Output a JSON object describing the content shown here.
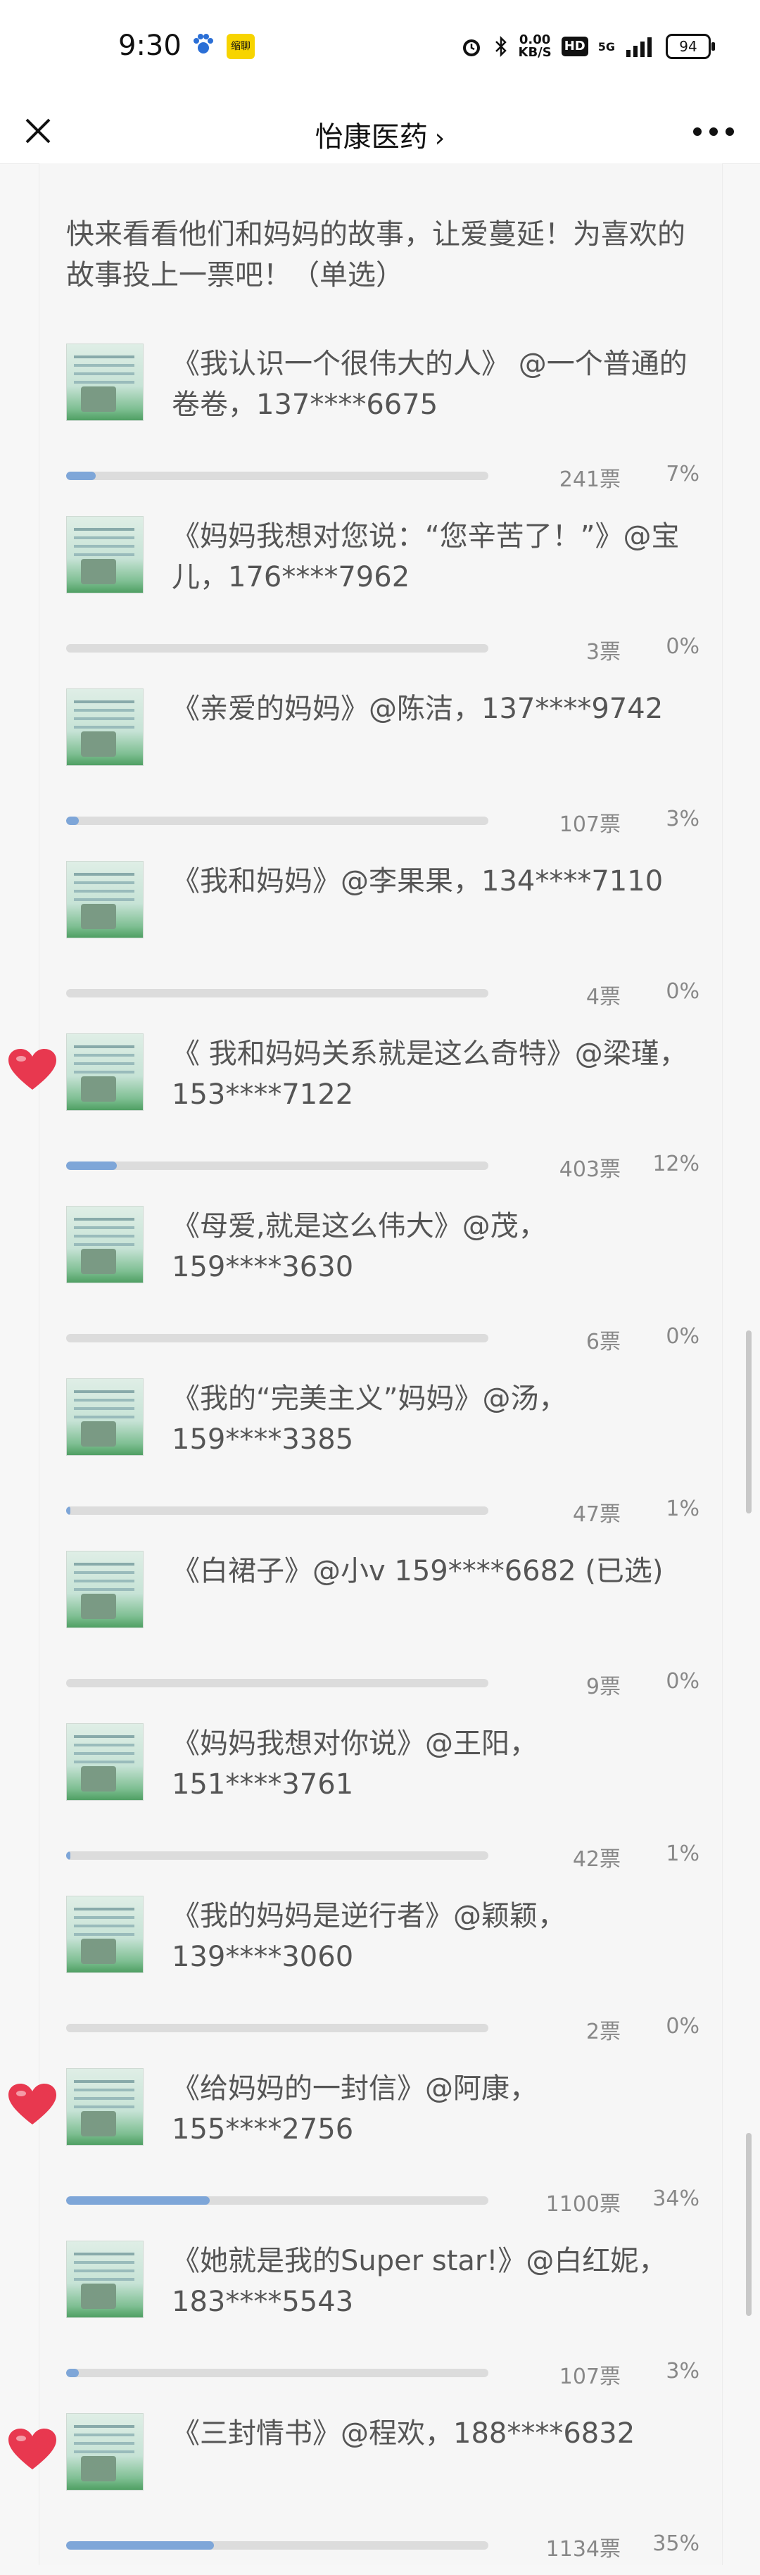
{
  "status_bar": {
    "time": "9:30",
    "app_badge": "缩聊",
    "network_speed": "0.00\nKB/S",
    "hd": "HD",
    "signal": "5G",
    "battery": "94"
  },
  "nav": {
    "title": "怡康医药",
    "chevron": "›"
  },
  "intro": "快来看看他们和妈妈的故事，让爱蔓延！为喜欢的故事投上一票吧！（单选）",
  "options": [
    {
      "text": "《我认识一个很伟大的人》 @一个普通的卷卷，137****6675",
      "votes_label": "241票",
      "pct_label": "7%",
      "pct": 7,
      "hearted": false
    },
    {
      "text": "《妈妈我想对您说：“您辛苦了！”》@宝儿，176****7962",
      "votes_label": "3票",
      "pct_label": "0%",
      "pct": 0,
      "hearted": false
    },
    {
      "text": "《亲爱的妈妈》@陈洁，137****9742",
      "votes_label": "107票",
      "pct_label": "3%",
      "pct": 3,
      "hearted": false
    },
    {
      "text": "《我和妈妈》@李果果，134****7110",
      "votes_label": "4票",
      "pct_label": "0%",
      "pct": 0,
      "hearted": false
    },
    {
      "text": "《 我和妈妈关系就是这么奇特》@梁瑾，153****7122",
      "votes_label": "403票",
      "pct_label": "12%",
      "pct": 12,
      "hearted": true
    },
    {
      "text": "《母爱,就是这么伟大》@茂，159****3630",
      "votes_label": "6票",
      "pct_label": "0%",
      "pct": 0,
      "hearted": false
    },
    {
      "text": "《我的“完美主义”妈妈》@汤，159****3385",
      "votes_label": "47票",
      "pct_label": "1%",
      "pct": 1,
      "hearted": false
    },
    {
      "text": "《白裙子》@小v 159****6682 (已选)",
      "votes_label": "9票",
      "pct_label": "0%",
      "pct": 0,
      "hearted": false
    },
    {
      "text": "《妈妈我想对你说》@王阳，151****3761",
      "votes_label": "42票",
      "pct_label": "1%",
      "pct": 1,
      "hearted": false
    },
    {
      "text": "《我的妈妈是逆行者》@颖颖，139****3060",
      "votes_label": "2票",
      "pct_label": "0%",
      "pct": 0,
      "hearted": false
    },
    {
      "text": "《给妈妈的一封信》@阿康，155****2756",
      "votes_label": "1100票",
      "pct_label": "34%",
      "pct": 34,
      "hearted": true
    },
    {
      "text": "《她就是我的Super star!》@白红妮，183****5543",
      "votes_label": "107票",
      "pct_label": "3%",
      "pct": 3,
      "hearted": false
    },
    {
      "text": "《三封情书》@程欢，188****6832",
      "votes_label": "1134票",
      "pct_label": "35%",
      "pct": 35,
      "hearted": true
    }
  ],
  "colors": {
    "bar_fill": "#7ea6d8",
    "bar_track": "#dcdcdc",
    "heart": "#e8384f"
  },
  "icons": {
    "close": "close-icon",
    "more": "more-icon",
    "heart": "heart-icon",
    "thumbnail": "story-thumbnail"
  }
}
